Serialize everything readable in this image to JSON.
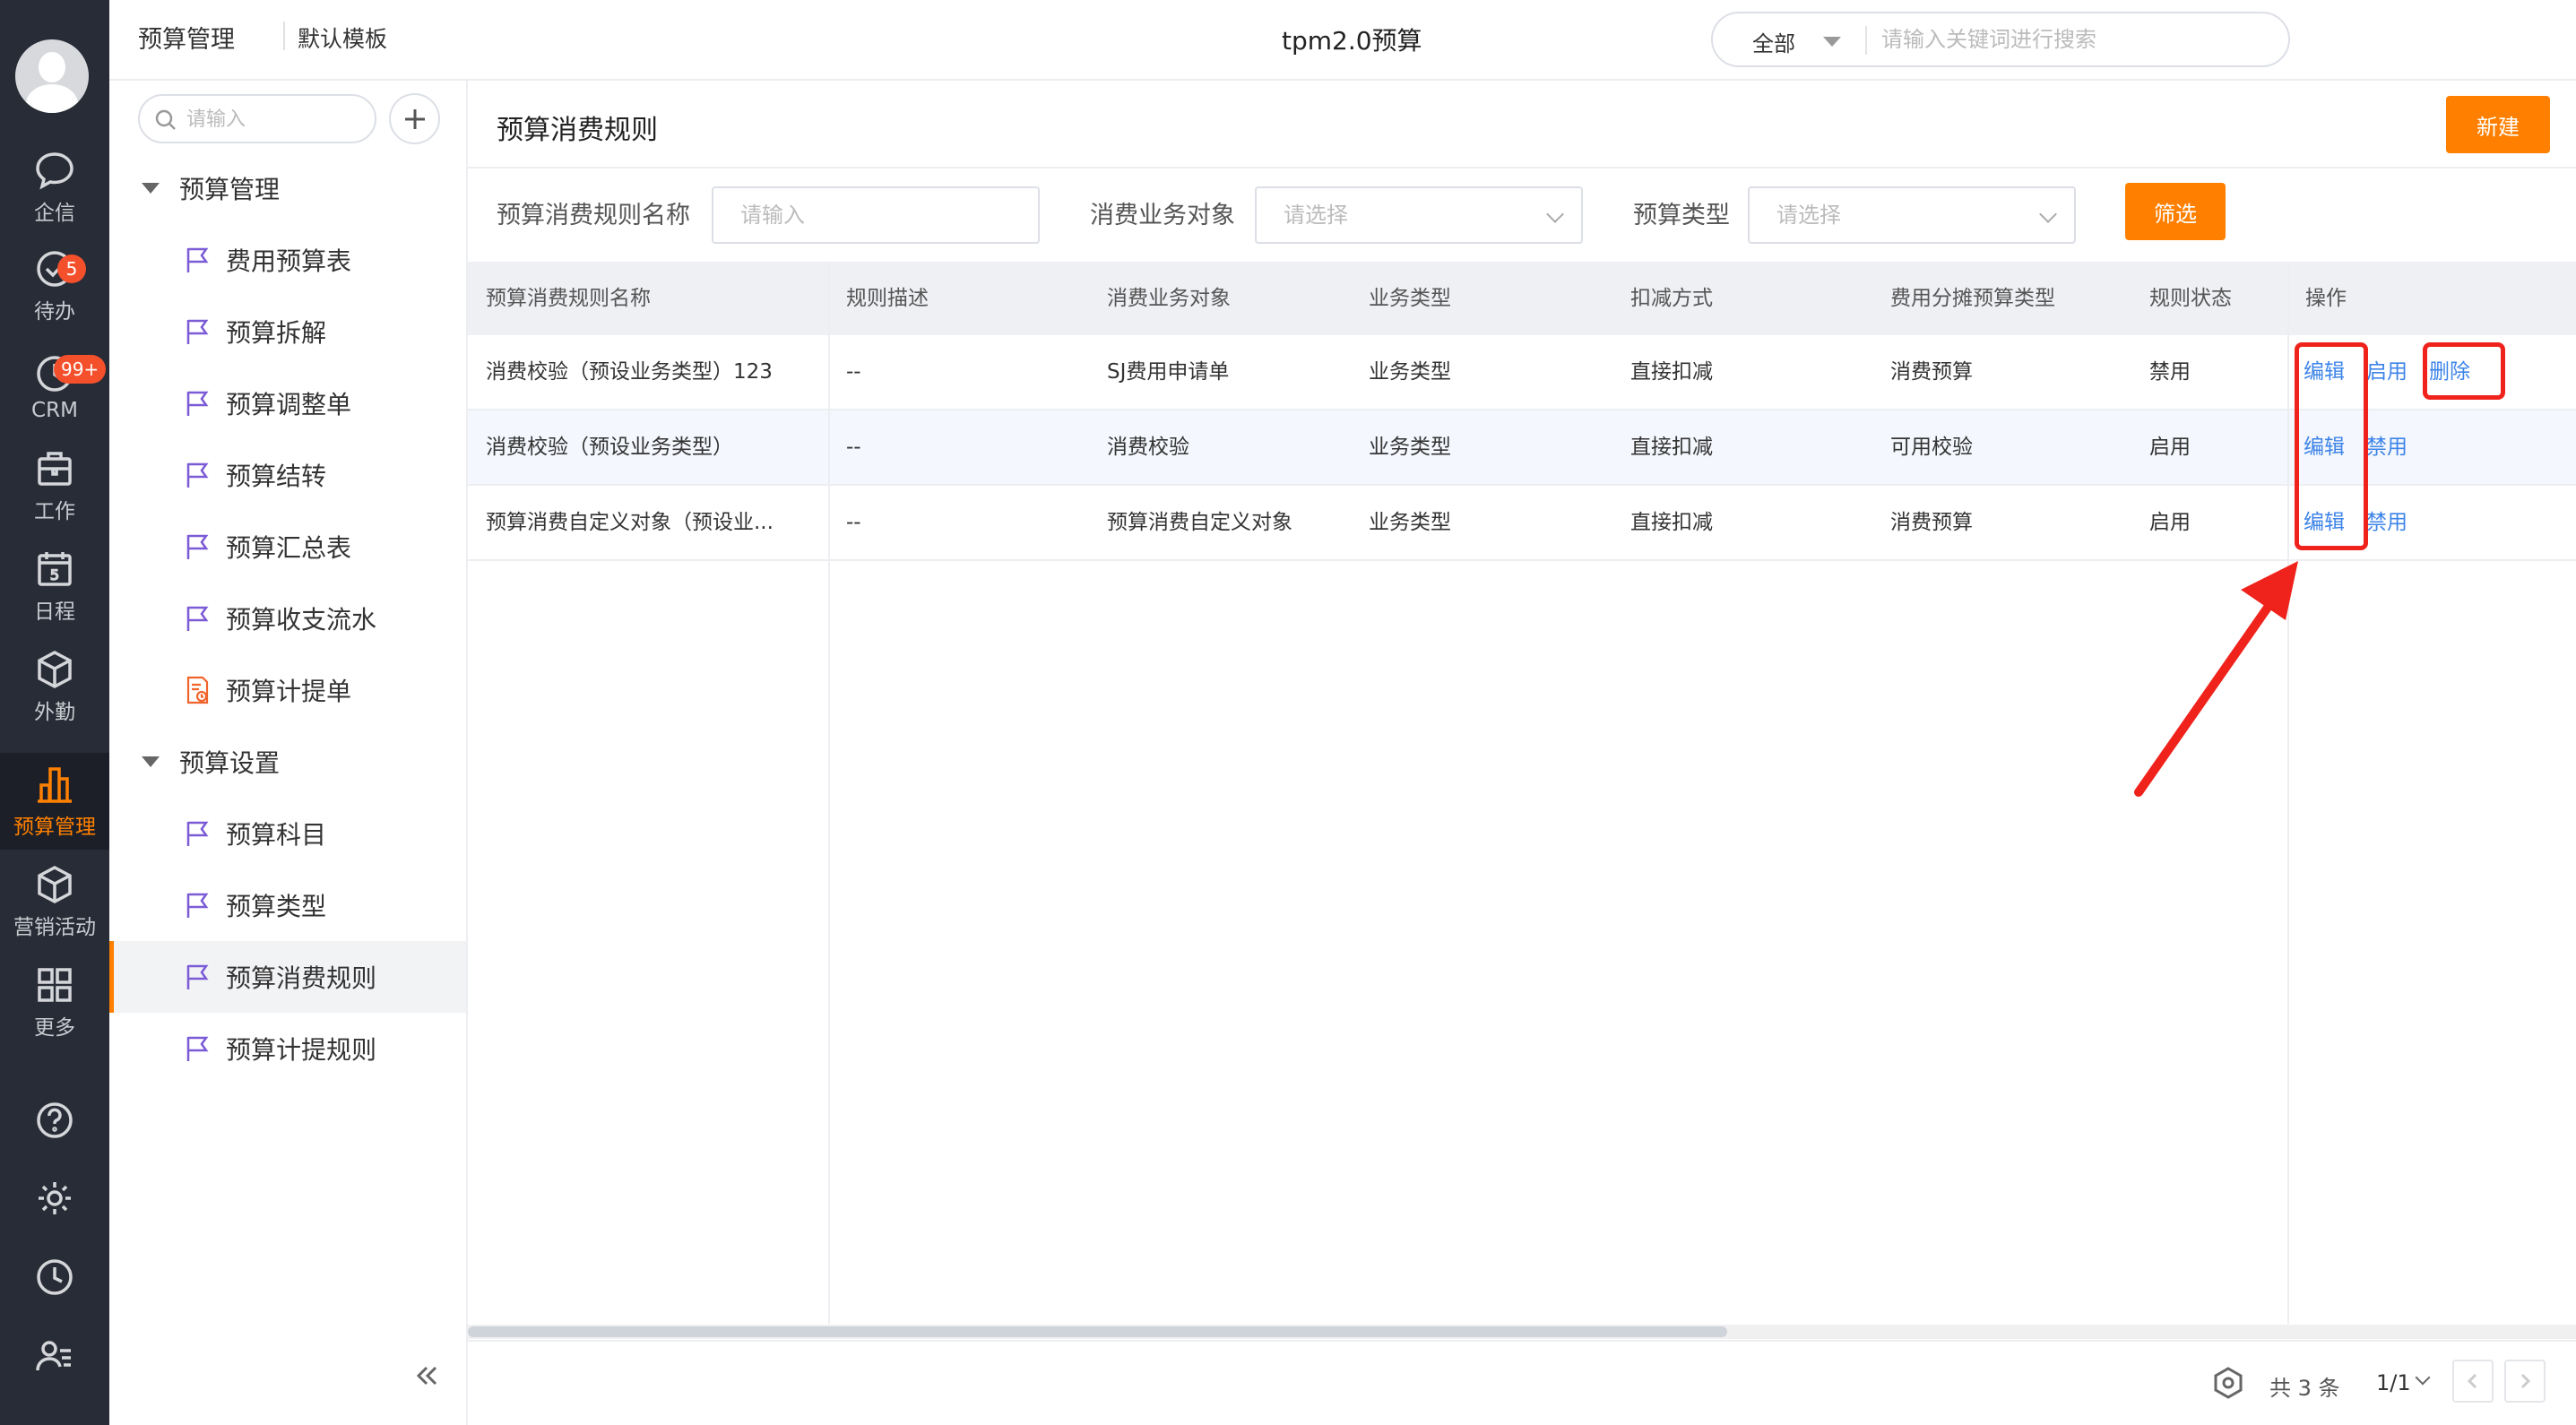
{
  "header": {
    "breadcrumb_module": "预算管理",
    "breadcrumb_template": "默认模板",
    "app_title": "tpm2.0预算",
    "search_scope": "全部",
    "search_placeholder": "请输入关键词进行搜索"
  },
  "rail": {
    "items": [
      {
        "label": "企信",
        "icon": "chat-bubble-icon"
      },
      {
        "label": "待办",
        "icon": "check-circle-icon",
        "badge": "5"
      },
      {
        "label": "CRM",
        "icon": "crm-clock-icon",
        "badge": "99+"
      },
      {
        "label": "工作",
        "icon": "briefcase-icon"
      },
      {
        "label": "日程",
        "icon": "calendar-icon",
        "calendar_day": "5"
      },
      {
        "label": "外勤",
        "icon": "cube-icon"
      },
      {
        "label": "预算管理",
        "icon": "bar-chart-icon",
        "active": true
      },
      {
        "label": "营销活动",
        "icon": "box-icon"
      },
      {
        "label": "更多",
        "icon": "grid-icon"
      }
    ],
    "bottom_icons": [
      "help-icon",
      "settings-icon",
      "history-icon",
      "user-list-icon"
    ]
  },
  "sidebar": {
    "search_placeholder": "请输入",
    "groups": [
      {
        "label": "预算管理",
        "items": [
          {
            "label": "费用预算表",
            "icon": "flag-icon"
          },
          {
            "label": "预算拆解",
            "icon": "flag-icon"
          },
          {
            "label": "预算调整单",
            "icon": "flag-icon"
          },
          {
            "label": "预算结转",
            "icon": "flag-icon"
          },
          {
            "label": "预算汇总表",
            "icon": "flag-icon"
          },
          {
            "label": "预算收支流水",
            "icon": "flag-icon"
          },
          {
            "label": "预算计提单",
            "icon": "document-clock-icon"
          }
        ]
      },
      {
        "label": "预算设置",
        "items": [
          {
            "label": "预算科目",
            "icon": "flag-icon"
          },
          {
            "label": "预算类型",
            "icon": "flag-icon"
          },
          {
            "label": "预算消费规则",
            "icon": "flag-icon",
            "active": true
          },
          {
            "label": "预算计提规则",
            "icon": "flag-icon"
          }
        ]
      }
    ]
  },
  "main": {
    "page_title": "预算消费规则",
    "new_button": "新建",
    "filters": {
      "name_label": "预算消费规则名称",
      "name_placeholder": "请输入",
      "object_label": "消费业务对象",
      "object_placeholder": "请选择",
      "type_label": "预算类型",
      "type_placeholder": "请选择",
      "filter_button": "筛选"
    },
    "table": {
      "columns": [
        "预算消费规则名称",
        "规则描述",
        "消费业务对象",
        "业务类型",
        "扣减方式",
        "费用分摊预算类型",
        "规则状态",
        "操作"
      ],
      "rows": [
        {
          "name": "消费校验（预设业务类型）123",
          "desc": "--",
          "object": "SJ费用申请单",
          "biz_type": "业务类型",
          "deduct": "直接扣减",
          "alloc_type": "消费预算",
          "status": "禁用",
          "actions": [
            "编辑",
            "启用",
            "删除"
          ]
        },
        {
          "name": "消费校验（预设业务类型）",
          "desc": "--",
          "object": "消费校验",
          "biz_type": "业务类型",
          "deduct": "直接扣减",
          "alloc_type": "可用校验",
          "status": "启用",
          "actions": [
            "编辑",
            "禁用"
          ]
        },
        {
          "name": "预算消费自定义对象（预设业...",
          "desc": "--",
          "object": "预算消费自定义对象",
          "biz_type": "业务类型",
          "deduct": "直接扣减",
          "alloc_type": "消费预算",
          "status": "启用",
          "actions": [
            "编辑",
            "禁用"
          ]
        }
      ]
    },
    "pagination": {
      "total": "共 3 条",
      "page": "1/1"
    }
  },
  "annotation_color": "#f0231c",
  "accent_color": "#ff8000"
}
